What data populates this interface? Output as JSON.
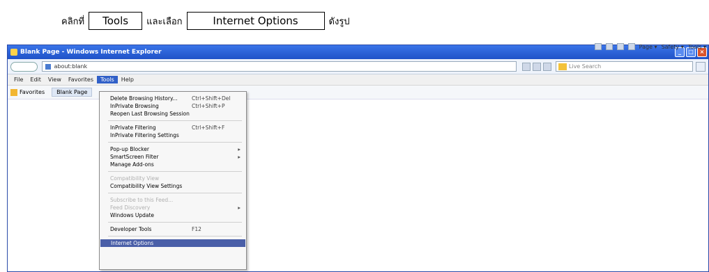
{
  "instruction": {
    "prefix": "คลิกที่",
    "step1": "Tools",
    "middle": "และเลือก",
    "step2": "Internet Options",
    "suffix": "ดังรูป"
  },
  "window": {
    "title": "Blank Page - Windows Internet Explorer",
    "address": "about:blank",
    "search_placeholder": "Live Search",
    "controls": {
      "minimize": "_",
      "maximize": "□",
      "close": "×"
    }
  },
  "menubar": {
    "items": [
      "File",
      "Edit",
      "View",
      "Favorites",
      "Tools",
      "Help"
    ],
    "active": "Tools"
  },
  "favbar": {
    "favorites_label": "Favorites",
    "tab_label": "Blank Page"
  },
  "cmdbar": {
    "page_label": "Page ▾",
    "safety_label": "Safety ▾",
    "tools_label": "Tools ▾"
  },
  "tools_menu": {
    "items": [
      {
        "label": "Delete Browsing History...",
        "shortcut": "Ctrl+Shift+Del"
      },
      {
        "label": "InPrivate Browsing",
        "shortcut": "Ctrl+Shift+P"
      },
      {
        "label": "Reopen Last Browsing Session",
        "shortcut": ""
      },
      {
        "label": "InPrivate Filtering",
        "shortcut": "Ctrl+Shift+F"
      },
      {
        "label": "InPrivate Filtering Settings",
        "shortcut": ""
      },
      {
        "label": "Pop-up Blocker",
        "arrow": "▸"
      },
      {
        "label": "SmartScreen Filter",
        "arrow": "▸"
      },
      {
        "label": "Manage Add-ons"
      },
      {
        "label": "Compatibility View"
      },
      {
        "label": "Compatibility View Settings"
      },
      {
        "label": "Subscribe to this Feed..."
      },
      {
        "label": "Feed Discovery",
        "arrow": "▸"
      },
      {
        "label": "Windows Update"
      },
      {
        "label": "Developer Tools",
        "shortcut": "F12"
      },
      {
        "label": "Internet Options"
      }
    ]
  }
}
